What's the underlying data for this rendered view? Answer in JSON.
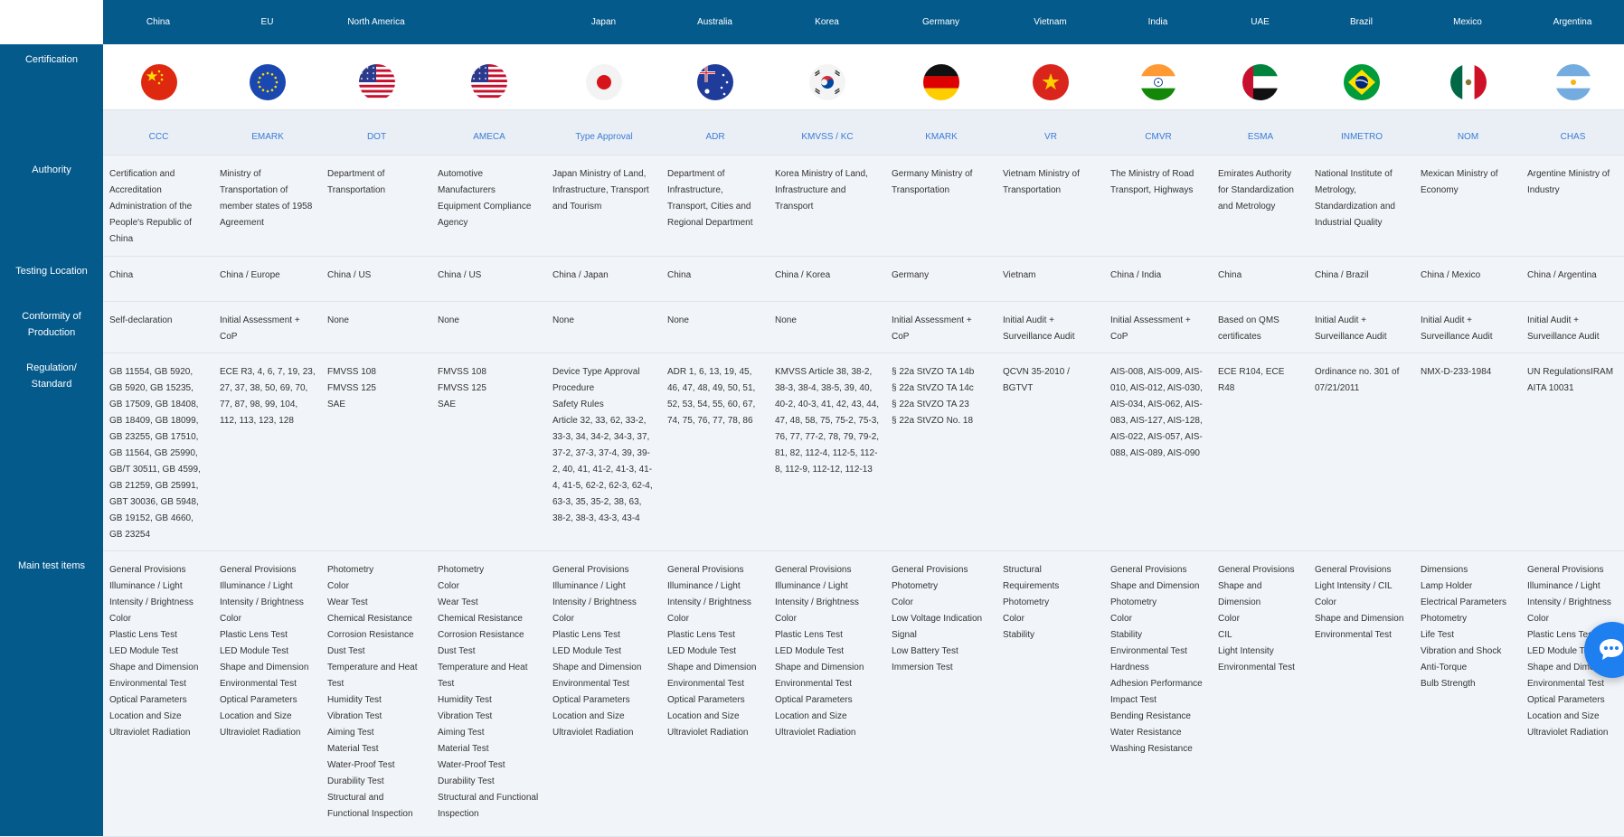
{
  "countries": [
    {
      "name": "China",
      "flag": "china",
      "cert": "CCC",
      "authority": "Certification and Accreditation Administration of the People's Republic of China",
      "location": "China",
      "conformity": "Self-declaration",
      "regulation": [
        "GB 11554, GB 5920, GB 5920, GB 15235, GB 17509, GB 18408, GB 18409, GB 18099, GB 23255, GB 17510, GB 11564, GB 25990, GB/T 30511, GB 4599, GB 21259, GB 25991, GBT 30036, GB 5948, GB 19152, GB 4660, GB 23254"
      ],
      "tests": [
        "General Provisions",
        "Illuminance / Light Intensity / Brightness",
        "Color",
        "Plastic Lens Test",
        "LED Module Test",
        "Shape and Dimension",
        "Environmental Test",
        "Optical Parameters",
        "Location and Size",
        "Ultraviolet Radiation"
      ]
    },
    {
      "name": "EU",
      "flag": "eu",
      "cert": "EMARK",
      "authority": "Ministry of Transportation of member states of 1958 Agreement",
      "location": "China / Europe",
      "conformity": "Initial Assessment + CoP",
      "regulation": [
        "ECE R3, 4, 6, 7, 19, 23, 27, 37, 38, 50, 69, 70, 77, 87, 98, 99, 104, 112, 113, 123, 128"
      ],
      "tests": [
        "General Provisions",
        "Illuminance / Light Intensity / Brightness",
        "Color",
        "Plastic Lens Test",
        "LED Module Test",
        "Shape and Dimension",
        "Environmental Test",
        "Optical Parameters",
        "Location and Size",
        "Ultraviolet Radiation"
      ]
    },
    {
      "name": "North America",
      "flag": "us",
      "cert": "DOT",
      "authority": "Department of Transportation",
      "location": "China / US",
      "conformity": "None",
      "regulation": [
        "FMVSS 108",
        "FMVSS 125",
        "SAE"
      ],
      "tests": [
        "Photometry",
        "Color",
        "Wear Test",
        "Chemical Resistance",
        "Corrosion Resistance",
        "Dust Test",
        "Temperature and Heat Test",
        "Humidity Test",
        "Vibration Test",
        "Aiming Test",
        "Material Test",
        "Water-Proof Test",
        "Durability Test",
        "Structural and Functional Inspection"
      ]
    },
    {
      "name": "",
      "flag": "us",
      "cert": "AMECA",
      "authority": "Automotive Manufacturers Equipment Compliance Agency",
      "location": "China / US",
      "conformity": "None",
      "regulation": [
        "FMVSS 108",
        "FMVSS 125",
        "SAE"
      ],
      "tests": [
        "Photometry",
        "Color",
        "Wear Test",
        "Chemical Resistance",
        "Corrosion Resistance",
        "Dust Test",
        "Temperature and Heat Test",
        "Humidity Test",
        "Vibration Test",
        "Aiming Test",
        "Material Test",
        "Water-Proof Test",
        "Durability Test",
        "Structural and Functional Inspection"
      ]
    },
    {
      "name": "Japan",
      "flag": "japan",
      "cert": "Type Approval",
      "authority": "Japan Ministry of Land, Infrastructure, Transport and Tourism",
      "location": "China / Japan",
      "conformity": "None",
      "regulation": [
        "Device Type Approval Procedure",
        "Safety Rules",
        "Article 32, 33, 62, 33-2, 33-3, 34, 34-2, 34-3, 37, 37-2, 37-3, 37-4, 39, 39-2, 40, 41, 41-2, 41-3, 41-4, 41-5, 62-2, 62-3, 62-4, 63-3, 35, 35-2, 38, 63, 38-2, 38-3, 43-3, 43-4"
      ],
      "tests": [
        "General Provisions",
        "Illuminance / Light Intensity / Brightness",
        "Color",
        "Plastic Lens Test",
        "LED Module Test",
        "Shape and Dimension",
        "Environmental Test",
        "Optical Parameters",
        "Location and Size",
        "Ultraviolet Radiation"
      ]
    },
    {
      "name": "Australia",
      "flag": "australia",
      "cert": "ADR",
      "authority": "Department of Infrastructure, Transport, Cities and Regional Department",
      "location": "China",
      "conformity": "None",
      "regulation": [
        "ADR 1, 6, 13, 19, 45, 46, 47, 48, 49, 50, 51, 52, 53, 54, 55, 60, 67, 74, 75, 76, 77, 78, 86"
      ],
      "tests": [
        "General Provisions",
        "Illuminance / Light Intensity / Brightness",
        "Color",
        "Plastic Lens Test",
        "LED Module Test",
        "Shape and Dimension",
        "Environmental Test",
        "Optical Parameters",
        "Location and Size",
        "Ultraviolet Radiation"
      ]
    },
    {
      "name": "Korea",
      "flag": "korea",
      "cert": "KMVSS / KC",
      "authority": "Korea Ministry of Land, Infrastructure and Transport",
      "location": "China / Korea",
      "conformity": "None",
      "regulation": [
        "KMVSS Article 38, 38-2, 38-3, 38-4, 38-5, 39, 40, 40-2, 40-3, 41, 42, 43, 44, 47, 48, 58, 75, 75-2, 75-3, 76, 77, 77-2, 78, 79, 79-2, 81, 82, 112-4, 112-5, 112-8, 112-9, 112-12, 112-13"
      ],
      "tests": [
        "General Provisions",
        "Illuminance / Light Intensity / Brightness",
        "Color",
        "Plastic Lens Test",
        "LED Module Test",
        "Shape and Dimension",
        "Environmental Test",
        "Optical Parameters",
        "Location and Size",
        "Ultraviolet Radiation"
      ]
    },
    {
      "name": "Germany",
      "flag": "germany",
      "cert": "KMARK",
      "authority": "Germany Ministry of Transportation",
      "location": "Germany",
      "conformity": "Initial Assessment + CoP",
      "regulation": [
        "§ 22a StVZO TA 14b",
        "§ 22a StVZO TA 14c",
        "§ 22a StVZO TA 23",
        "§ 22a StVZO No. 18"
      ],
      "tests": [
        "General Provisions",
        "Photometry",
        "Color",
        "Low Voltage Indication Signal",
        "Low Battery Test",
        "Immersion Test"
      ]
    },
    {
      "name": "Vietnam",
      "flag": "vietnam",
      "cert": "VR",
      "authority": "Vietnam Ministry of Transportation",
      "location": "Vietnam",
      "conformity": "Initial Audit + Surveillance Audit",
      "regulation": [
        "QCVN 35-2010 / BGTVT"
      ],
      "tests": [
        "Structural Requirements",
        "Photometry",
        "Color",
        "Stability"
      ]
    },
    {
      "name": "India",
      "flag": "india",
      "cert": "CMVR",
      "authority": "The Ministry of Road Transport, Highways",
      "location": "China / India",
      "conformity": "Initial Assessment + CoP",
      "regulation": [
        "AIS-008, AIS-009, AIS-010, AIS-012, AIS-030, AIS-034, AIS-062, AIS-083, AIS-127, AIS-128, AIS-022, AIS-057, AIS-088, AIS-089, AIS-090"
      ],
      "tests": [
        "General Provisions",
        "Shape and Dimension",
        "Photometry",
        "Color",
        "Stability",
        "Environmental Test",
        "Hardness",
        "Adhesion Performance",
        "Impact Test",
        "Bending Resistance",
        "Water Resistance",
        "Washing Resistance"
      ]
    },
    {
      "name": "UAE",
      "flag": "uae",
      "cert": "ESMA",
      "authority": "Emirates Authority for Standardization and Metrology",
      "location": "China",
      "conformity": "Based on QMS certificates",
      "regulation": [
        "ECE R104, ECE R48"
      ],
      "tests": [
        "General Provisions",
        "Shape and Dimension",
        "Color",
        "CIL",
        "Light Intensity",
        "Environmental Test"
      ]
    },
    {
      "name": "Brazil",
      "flag": "brazil",
      "cert": "INMETRO",
      "authority": "National Institute of Metrology, Standardization and Industrial Quality",
      "location": "China / Brazil",
      "conformity": "Initial Audit + Surveillance Audit",
      "regulation": [
        "Ordinance no. 301 of 07/21/2011"
      ],
      "tests": [
        "General Provisions",
        "Light Intensity / CIL",
        "Color",
        "Shape and Dimension",
        "Environmental Test"
      ]
    },
    {
      "name": "Mexico",
      "flag": "mexico",
      "cert": "NOM",
      "authority": "Mexican Ministry of Economy",
      "location": "China / Mexico",
      "conformity": "Initial Audit + Surveillance Audit",
      "regulation": [
        "NMX-D-233-1984"
      ],
      "tests": [
        "Dimensions",
        "Lamp Holder",
        "Electrical Parameters",
        "Photometry",
        "Life Test",
        "Vibration and Shock",
        "Anti-Torque",
        "Bulb Strength"
      ]
    },
    {
      "name": "Argentina",
      "flag": "argentina",
      "cert": "CHAS",
      "authority": "Argentine Ministry of Industry",
      "location": "China / Argentina",
      "conformity": "Initial Audit + Surveillance Audit",
      "regulation": [
        "UN RegulationsIRAM AITA 10031"
      ],
      "tests": [
        "General Provisions",
        "Illuminance / Light Intensity / Brightness",
        "Color",
        "Plastic Lens Test",
        "LED Module Test",
        "Shape and Dimension",
        "Environmental Test",
        "Optical Parameters",
        "Location and Size",
        "Ultraviolet Radiation"
      ]
    }
  ],
  "row_labels": {
    "certification": "Certification",
    "authority": "Authority",
    "location": "Testing Location",
    "conformity": "Conformity of Production",
    "regulation": "Regulation/ Standard",
    "tests": "Main test items"
  },
  "colors": {
    "header_bg": "#055a8c",
    "link": "#3a7bd5",
    "chat_button": "#1e7ff0"
  },
  "icons": {
    "chat": "chat-bubble-icon"
  }
}
